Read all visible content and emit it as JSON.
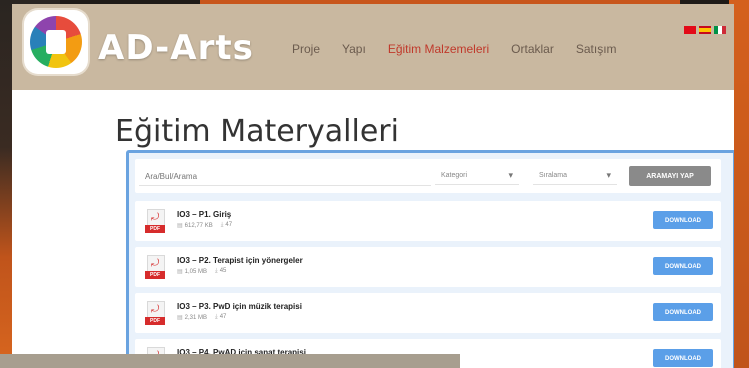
{
  "brand": {
    "name": "AD-Arts",
    "logo_icon": "ad-arts-logo"
  },
  "nav": {
    "items": [
      {
        "label": "Proje"
      },
      {
        "label": "Yapı"
      },
      {
        "label": "Eğitim Malzemeleri",
        "active": true
      },
      {
        "label": "Ortaklar"
      },
      {
        "label": "Satışım"
      }
    ]
  },
  "flags": [
    "tr",
    "es",
    "it"
  ],
  "page": {
    "title": "Eğitim Materyalleri"
  },
  "filter": {
    "search_placeholder": "Ara/Bul/Arama",
    "select_1": "Kategori",
    "select_2": "Sıralama",
    "apply_label": "ARAMAYI YAP"
  },
  "documents": [
    {
      "title": "IO3 – P1. Giriş",
      "size": "612,77 KB",
      "downloads": "47",
      "download_label": "DOWNLOAD"
    },
    {
      "title": "IO3 – P2. Terapist için yönergeler",
      "size": "1,05 MB",
      "downloads": "45",
      "download_label": "DOWNLOAD"
    },
    {
      "title": "IO3 – P3. PwD için müzik terapisi",
      "size": "2,31 MB",
      "downloads": "47",
      "download_label": "DOWNLOAD"
    },
    {
      "title": "IO3 – P4. PwAD için sanat terapisi",
      "size": "",
      "downloads": "",
      "download_label": "DOWNLOAD"
    }
  ],
  "colors": {
    "accent": "#5b9fe8",
    "panel_border": "#6aa3e0",
    "header_bg": "#c9b8a0",
    "nav_active": "#c0392b",
    "pdf_red": "#d62c2c"
  }
}
